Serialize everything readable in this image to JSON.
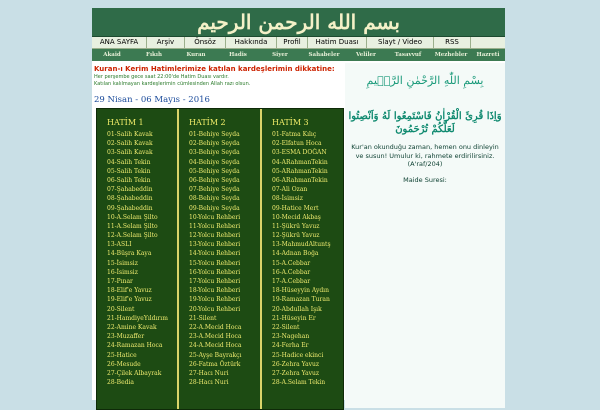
{
  "header": {
    "title": "بسم الله الرحمن الرحيم"
  },
  "nav_primary": [
    "ANA SAYFA",
    "Arşiv",
    "Önsöz",
    "Hakkında",
    "Profil",
    "Hatim Duası",
    "Slayt / Video",
    "RSS"
  ],
  "nav_secondary": [
    "Akaid",
    "Fıkıh",
    "Kuran",
    "Hadis",
    "Siyer",
    "Sahabeler",
    "Veliler",
    "Tasavvuf",
    "Mezhebler",
    "Hazreti"
  ],
  "notice": {
    "heading": "Kuran-ı Kerim Hatimlerimize katılan kardeşlerimin dikkatine:",
    "line1": "Her perşembe gece saat 22:00'de Hatim Duası vardır.",
    "line2": "Katılan kalılmayan kardeşlerimin cümlesinden Allah razı olsun."
  },
  "date_range": "29 Nisan - 06 Mayıs - 2016",
  "hatim_columns": [
    {
      "title": "HATİM 1",
      "rows": [
        "01-Salih Kavak",
        "02-Salih Kavak",
        "03-Salih Kavak",
        "04-Salih Tekin",
        "05-Salih Tekin",
        "06-Salih Tekin",
        "07-Şahabeddin",
        "08-Şahabeddin",
        "09-Şahabeddin",
        "10-A.Selam Şilto",
        "11-A.Selam Şilto",
        "12-A.Selam Şilto",
        "13-ASLI",
        "14-Büşra Kaya",
        "15-İsimsiz",
        "16-İsimsiz",
        "17-Pınar",
        "18-Elif'e Yavuz",
        "19-Elif'e Yavuz",
        "20-Silent",
        "21-HamdiyeYıldırım",
        "22-Amine Kavak",
        "23-Muzaffer",
        "24-Ramazan Hoca",
        "25-Hatice",
        "26-Mesude",
        "27-Çilek Albayrak",
        "28-Bedia"
      ]
    },
    {
      "title": "HATİM 2",
      "rows": [
        "01-Behiye Seyda",
        "02-Behiye Seyda",
        "03-Behiye Seyda",
        "04-Behiye Seyda",
        "05-Behiye Seyda",
        "06-Behiye Seyda",
        "07-Behiye Seyda",
        "08-Behiye Seyda",
        "09-Behiye Seyda",
        "10-Yolcu Rehberi",
        "11-Yolcu Rehberi",
        "12-Yolcu Rehberi",
        "13-Yolcu Rehberi",
        "14-Yolcu Rehberi",
        "15-Yolcu Rehberi",
        "16-Yolcu Rehberi",
        "17-Yolcu Rehberi",
        "18-Yolcu Rehberi",
        "19-Yolcu Rehberi",
        "20-Yolcu Rehberi",
        "21-Silent",
        "22-A.Mecid Hoca",
        "23-A.Mecid Hoca",
        "24-A.Mecid Hoca",
        "25-Ayşe Bayrakçı",
        "26-Fatma Öztürk",
        "27-Hacı Nuri",
        "28-Hacı Nuri"
      ]
    },
    {
      "title": "HATİM 3",
      "rows": [
        "01-Fatma Kılıç",
        "02-Elfatun Hoca",
        "03-ESMA DOĞAN",
        "04-ARahmanTekin",
        "05-ARahmanTekin",
        "06-ARahmanTekin",
        "07-Ali Ozan",
        "08-İsimsiz",
        "09-Hatice Mert",
        "10-Mecid Akbaş",
        "11-Şükrü Yavuz",
        "12-Şükrü Yavuz",
        "13-MahmudAltuntş",
        "14-Adnan Boğa",
        "15-A.Cebbar",
        "16-A.Cebbar",
        "17-A.Cebbar",
        "18-Hüseyyin Aydın",
        "19-Ramazan Turan",
        "20-Abdullah Işık",
        "21-Hüseyin Er",
        "22-Silent",
        "23-Nagehan",
        "24-Ferha Er",
        "25-Hadice ekinci",
        "26-Zehra Yavuz",
        "27-Zehra Yavuz",
        "28-A.Selam Tekin"
      ]
    }
  ],
  "sidebar": {
    "bismillah": "بِسْمِ اللّٰهِ الرَّحْمٰنِ الرَّح۪يمِ",
    "ayah": "وَاِذَا قُرِئَ الْقُرْاٰنُ فَاسْتَمِعُوا لَهُ وَاَنْصِتُوا لَعَلَّكُمْ تُرْحَمُونَ",
    "translation": "Kur'an okunduğu zaman, hemen onu dinleyin ve susun! Umulur ki, rahmete erdirilirsiniz. (A'raf/204)",
    "source": "Maide Suresi:"
  },
  "colors": {
    "header_bg": "#2f6b48",
    "hatim_bg": "#1d4b13",
    "hatim_text": "#f0ec70",
    "notice_red": "#cc2200",
    "date_blue": "#1a4a9a",
    "ayah_green": "#108a70"
  }
}
